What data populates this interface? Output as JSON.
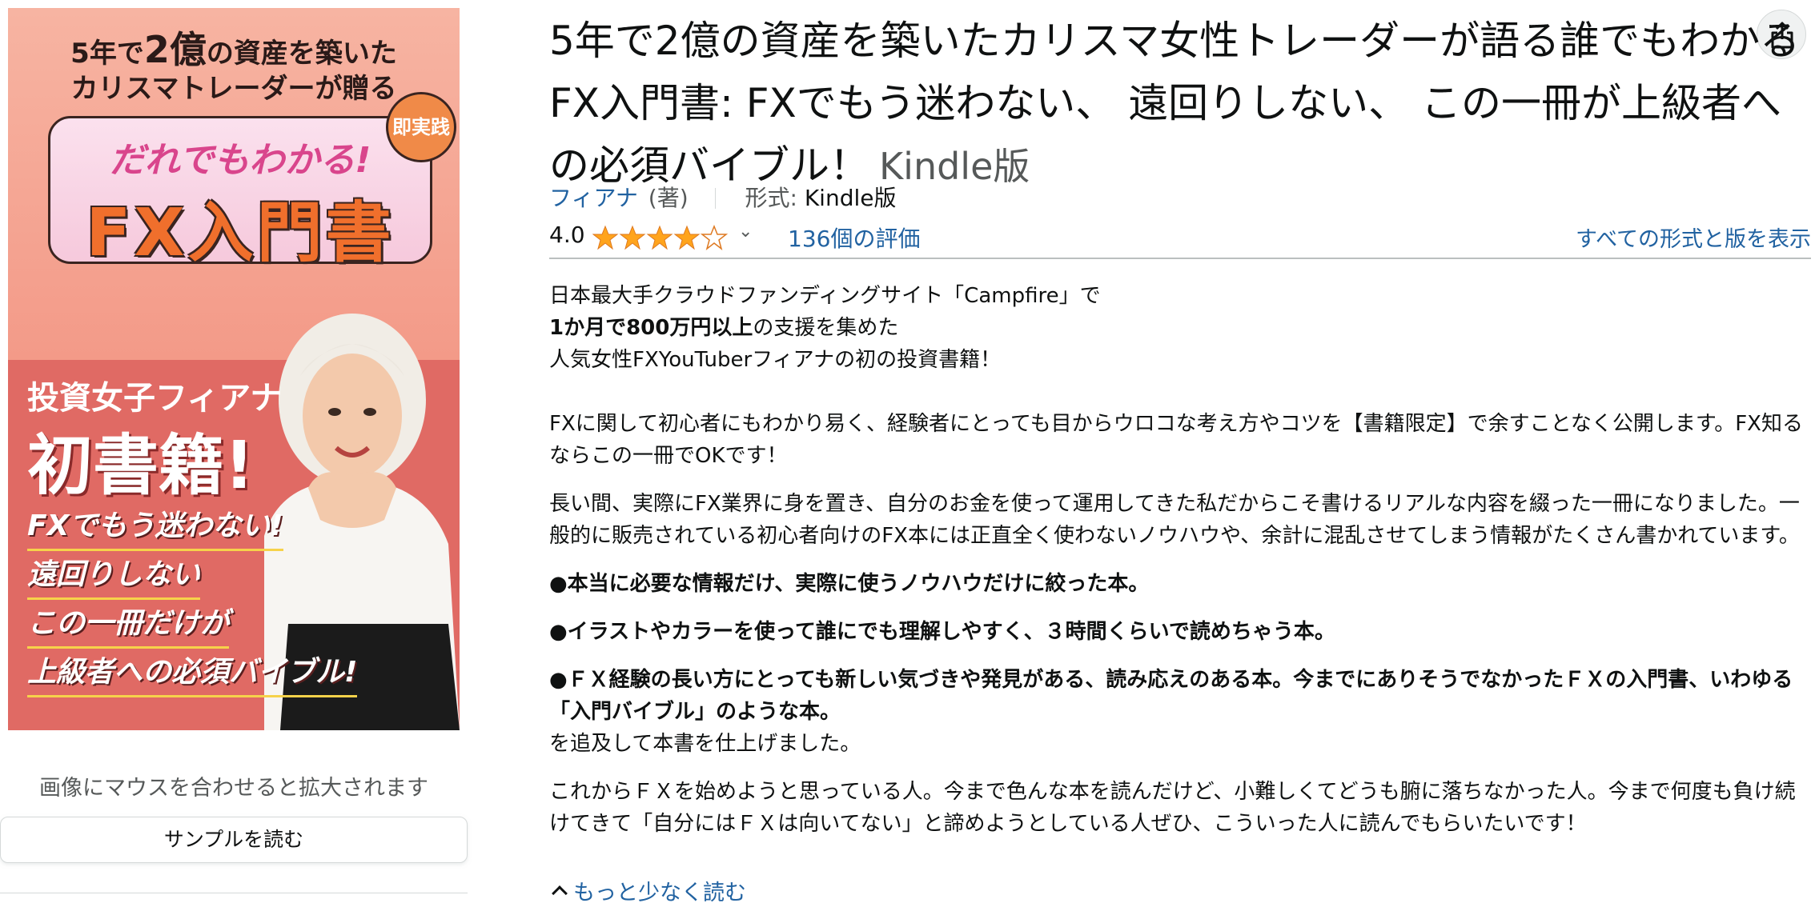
{
  "cover": {
    "top_line1_a": "5年で",
    "top_line1_b": "2億",
    "top_line1_c": "の資産を築いた",
    "top_line2": "カリスマトレーダーが贈る",
    "box_sub": "だれでもわかる!",
    "box_main": "FX入門書",
    "badge": "即実践",
    "author_line": "投資女子フィアナ",
    "first_book": "初書籍!",
    "lines": [
      "FXでもう迷わない!",
      "遠回りしない",
      "この一冊だけが",
      "上級者への必須バイブル!"
    ],
    "colors": {
      "top": "#f4a08e",
      "bottom": "#e06a64",
      "accent": "#f06f2c"
    }
  },
  "left": {
    "hover_hint": "画像にマウスを合わせると拡大されます",
    "sample_button": "サンプルを読む"
  },
  "product": {
    "title": "5年で2億の資産を築いたカリスマ女性トレーダーが語る誰でもわかるFX入門書: FXでもう迷わない、 遠回りしない、 この一冊が上級者への必須バイブル！",
    "format_suffix": "Kindle版",
    "author": "フィアナ",
    "author_role": "(著)",
    "format_label": "形式:",
    "format_value": "Kindle版",
    "rating": "4.0",
    "rating_stars": 4,
    "reviews": "136個の評価",
    "all_formats": "すべての形式と版を表示",
    "share_icon": "share-icon"
  },
  "description": {
    "l1": "日本最大手クラウドファンディングサイト「Campfire」で",
    "l2_bold": "1か月で800万円以上",
    "l2_rest": "の支援を集めた",
    "l3": "人気女性FXYouTuberフィアナの初の投資書籍！",
    "p2": "FXに関して初心者にもわかり易く、経験者にとっても目からウロコな考え方やコツを【書籍限定】で余すことなく公開します。FX知るならこの一冊でOKです！",
    "p3": "長い間、実際にFX業界に身を置き、自分のお金を使って運用してきた私だからこそ書けるリアルな内容を綴った一冊になりました。一般的に販売されている初心者向けのFX本には正直全く使わないノウハウや、余計に混乱させてしまう情報がたくさん書かれています。",
    "b1": "●本当に必要な情報だけ、実際に使うノウハウだけに絞った本。",
    "b2": "●イラストやカラーを使って誰にでも理解しやすく、３時間くらいで読めちゃう本。",
    "b3": "●ＦＸ経験の長い方にとっても新しい気づきや発見がある、読み応えのある本。今までにありそうでなかったＦＸの入門書、いわゆる「入門バイブル」のような本。",
    "p4": "を追及して本書を仕上げました。",
    "p5": "これからＦＸを始めようと思っている人。今まで色んな本を読んだけど、小難しくてどうも腑に落ちなかった人。今まで何度も負け続けてきて「自分にはＦＸは向いてない」と諦めようとしている人ぜひ、こういった人に読んでもらいたいです！",
    "collapse": "もっと少なく読む"
  }
}
